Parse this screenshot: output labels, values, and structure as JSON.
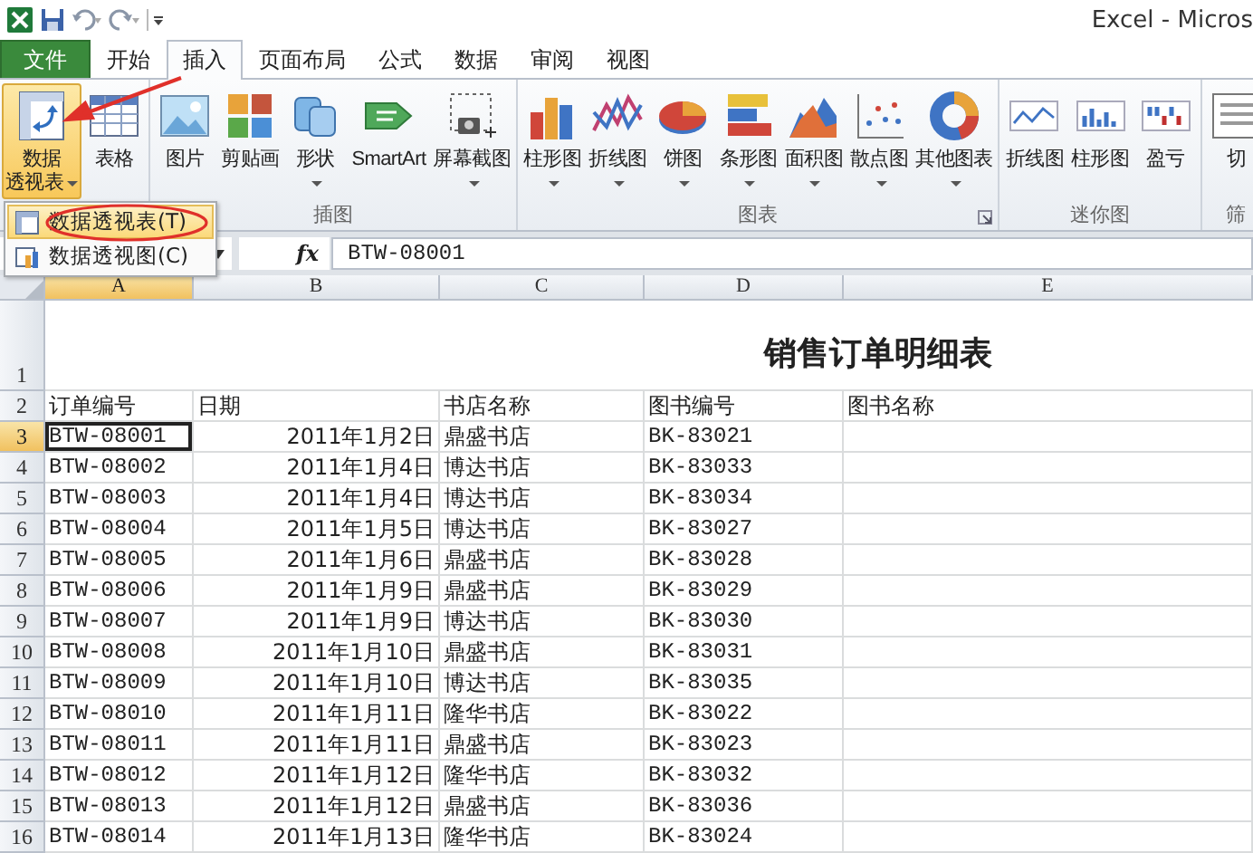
{
  "title_bar": {
    "title": "Excel - Micros"
  },
  "tabs": [
    {
      "label": "文件",
      "kind": "file",
      "selected": false
    },
    {
      "label": "开始",
      "kind": "tab",
      "selected": false
    },
    {
      "label": "插入",
      "kind": "tab",
      "selected": true
    },
    {
      "label": "页面布局",
      "kind": "tab",
      "selected": false
    },
    {
      "label": "公式",
      "kind": "tab",
      "selected": false
    },
    {
      "label": "数据",
      "kind": "tab",
      "selected": false
    },
    {
      "label": "审阅",
      "kind": "tab",
      "selected": false
    },
    {
      "label": "视图",
      "kind": "tab",
      "selected": false
    }
  ],
  "ribbon": {
    "groups": [
      {
        "buttons": [
          {
            "label": "数据透视表",
            "dropdown": true,
            "selected": true
          },
          {
            "label": "表格",
            "selected": false
          }
        ]
      },
      {
        "label": "插图",
        "buttons": [
          {
            "label": "图片",
            "selected": false
          },
          {
            "label": "剪贴画",
            "selected": false
          },
          {
            "label": "形状",
            "dropdown": true,
            "selected": false
          },
          {
            "label": "SmartArt",
            "selected": false
          },
          {
            "label": "屏幕截图",
            "dropdown": true,
            "selected": false
          }
        ]
      },
      {
        "label": "图表",
        "launcher": true,
        "buttons": [
          {
            "label": "柱形图",
            "dropdown": true,
            "selected": false
          },
          {
            "label": "折线图",
            "dropdown": true,
            "selected": false
          },
          {
            "label": "饼图",
            "dropdown": true,
            "selected": false
          },
          {
            "label": "条形图",
            "dropdown": true,
            "selected": false
          },
          {
            "label": "面积图",
            "dropdown": true,
            "selected": false
          },
          {
            "label": "散点图",
            "dropdown": true,
            "selected": false
          },
          {
            "label": "其他图表",
            "dropdown": true,
            "selected": false
          }
        ]
      },
      {
        "label": "迷你图",
        "buttons": [
          {
            "label": "折线图",
            "selected": false
          },
          {
            "label": "柱形图",
            "selected": false
          },
          {
            "label": "盈亏",
            "selected": false
          }
        ]
      },
      {
        "label": "筛",
        "buttons": [
          {
            "label": "切",
            "selected": false
          }
        ]
      }
    ]
  },
  "menu": {
    "items": [
      {
        "label": "数据透视表(T)",
        "selected": true,
        "circled": true
      },
      {
        "label": "数据透视图(C)",
        "selected": false,
        "circled": false
      }
    ]
  },
  "formula_bar": {
    "function_label": "fx",
    "value": "BTW-08001"
  },
  "sheet": {
    "columns": [
      {
        "label": "A",
        "selected": true
      },
      {
        "label": "B",
        "selected": false
      },
      {
        "label": "C",
        "selected": false
      },
      {
        "label": "D",
        "selected": false
      },
      {
        "label": "E",
        "selected": false
      }
    ],
    "title_row": {
      "header": "1",
      "title": "销售订单明细表"
    },
    "rows": [
      {
        "header": "2",
        "kind": "header",
        "selected": false,
        "cells": [
          "订单编号",
          "日期",
          "书店名称",
          "图书编号",
          "图书名称"
        ]
      },
      {
        "header": "3",
        "kind": "data",
        "selected": true,
        "cells": [
          "BTW-08001",
          "2011年1月2日",
          "鼎盛书店",
          "BK-83021"
        ]
      },
      {
        "header": "4",
        "kind": "data",
        "selected": false,
        "cells": [
          "BTW-08002",
          "2011年1月4日",
          "博达书店",
          "BK-83033"
        ]
      },
      {
        "header": "5",
        "kind": "data",
        "selected": false,
        "cells": [
          "BTW-08003",
          "2011年1月4日",
          "博达书店",
          "BK-83034"
        ]
      },
      {
        "header": "6",
        "kind": "data",
        "selected": false,
        "cells": [
          "BTW-08004",
          "2011年1月5日",
          "博达书店",
          "BK-83027"
        ]
      },
      {
        "header": "7",
        "kind": "data",
        "selected": false,
        "cells": [
          "BTW-08005",
          "2011年1月6日",
          "鼎盛书店",
          "BK-83028"
        ]
      },
      {
        "header": "8",
        "kind": "data",
        "selected": false,
        "cells": [
          "BTW-08006",
          "2011年1月9日",
          "鼎盛书店",
          "BK-83029"
        ]
      },
      {
        "header": "9",
        "kind": "data",
        "selected": false,
        "cells": [
          "BTW-08007",
          "2011年1月9日",
          "博达书店",
          "BK-83030"
        ]
      },
      {
        "header": "10",
        "kind": "data",
        "selected": false,
        "cells": [
          "BTW-08008",
          "2011年1月10日",
          "鼎盛书店",
          "BK-83031"
        ]
      },
      {
        "header": "11",
        "kind": "data",
        "selected": false,
        "cells": [
          "BTW-08009",
          "2011年1月10日",
          "博达书店",
          "BK-83035"
        ]
      },
      {
        "header": "12",
        "kind": "data",
        "selected": false,
        "cells": [
          "BTW-08010",
          "2011年1月11日",
          "隆华书店",
          "BK-83022"
        ]
      },
      {
        "header": "13",
        "kind": "data",
        "selected": false,
        "cells": [
          "BTW-08011",
          "2011年1月11日",
          "鼎盛书店",
          "BK-83023"
        ]
      },
      {
        "header": "14",
        "kind": "data",
        "selected": false,
        "cells": [
          "BTW-08012",
          "2011年1月12日",
          "隆华书店",
          "BK-83032"
        ]
      },
      {
        "header": "15",
        "kind": "data",
        "selected": false,
        "cells": [
          "BTW-08013",
          "2011年1月12日",
          "鼎盛书店",
          "BK-83036"
        ]
      },
      {
        "header": "16",
        "kind": "data",
        "selected": false,
        "cells": [
          "BTW-08014",
          "2011年1月13日",
          "隆华书店",
          "BK-83024"
        ]
      }
    ]
  },
  "pointer_arrow": true
}
